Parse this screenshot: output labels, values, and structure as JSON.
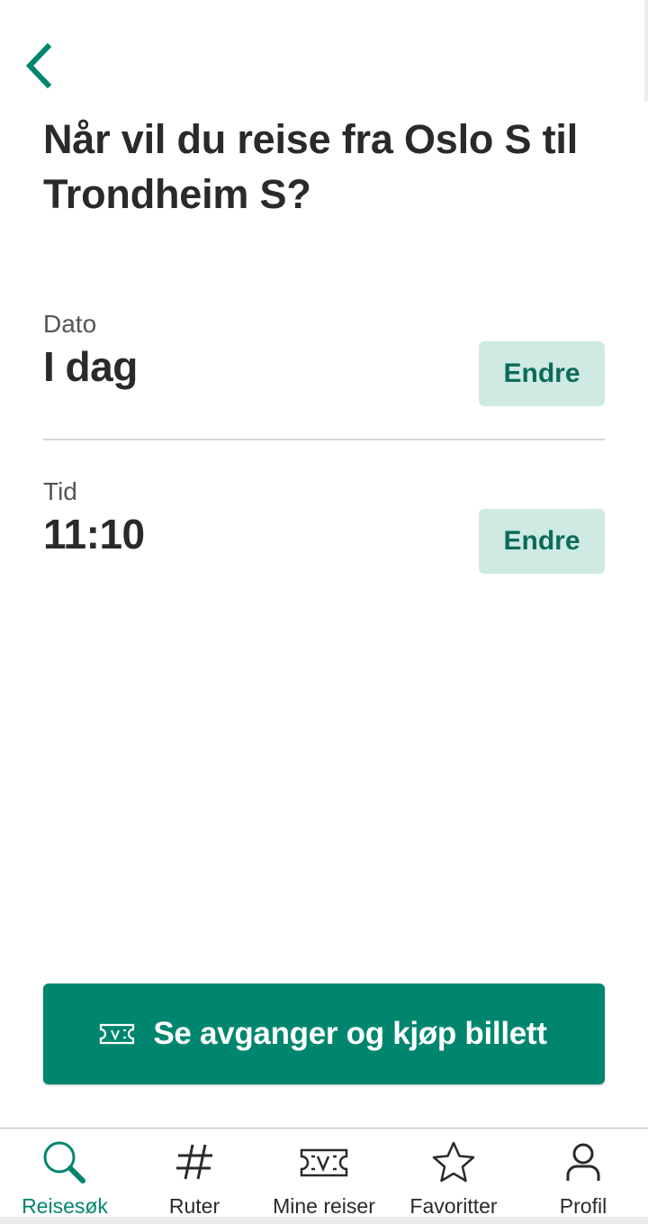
{
  "header": {
    "back_icon": "chevron-left-icon",
    "question": {
      "prefix": "Når vil du reise fra ",
      "from": "Oslo S",
      "middle": " til ",
      "to": "Trondheim S",
      "suffix": "?"
    }
  },
  "fields": {
    "date": {
      "label": "Dato",
      "value": "I dag",
      "button": "Endre"
    },
    "time": {
      "label": "Tid",
      "value": "11:10",
      "button": "Endre"
    }
  },
  "cta": {
    "icon": "ticket-icon",
    "label": "Se avganger og kjøp billett"
  },
  "tabbar": {
    "tabs": [
      {
        "label": "Reisesøk",
        "icon": "search-icon",
        "active": true
      },
      {
        "label": "Ruter",
        "icon": "hash-icon",
        "active": false
      },
      {
        "label": "Mine reiser",
        "icon": "ticket-icon",
        "active": false
      },
      {
        "label": "Favoritter",
        "icon": "star-icon",
        "active": false
      },
      {
        "label": "Profil",
        "icon": "person-icon",
        "active": false
      }
    ]
  },
  "colors": {
    "accent": "#00866e",
    "accent_light": "#cfeae3",
    "accent_text": "#0b6b5a",
    "text": "#2a2a2a"
  }
}
